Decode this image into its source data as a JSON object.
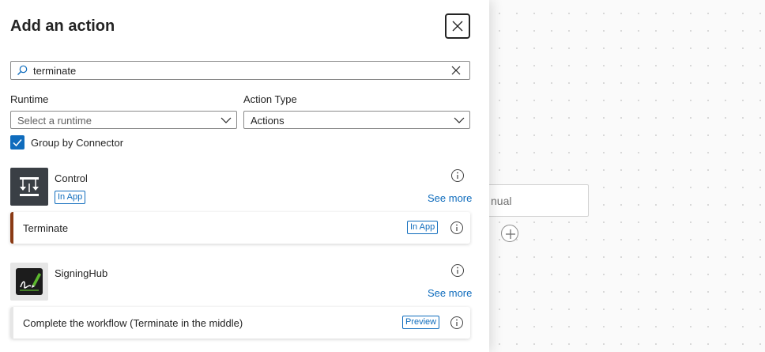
{
  "canvas": {
    "trigger_label": "nual"
  },
  "panel": {
    "title": "Add an action",
    "search": {
      "value": "terminate"
    },
    "runtime": {
      "label": "Runtime",
      "placeholder": "Select a runtime"
    },
    "action_type": {
      "label": "Action Type",
      "value": "Actions"
    },
    "group_by_connector": {
      "label": "Group by Connector",
      "checked": true
    },
    "connectors": [
      {
        "name": "Control",
        "badge": "In App",
        "see_more": "See more",
        "icon": "control-icon",
        "icon_bg": "#3a3f45",
        "actions": [
          {
            "label": "Terminate",
            "badge": "In App",
            "accent": "#8a3a14"
          }
        ]
      },
      {
        "name": "SigningHub",
        "see_more": "See more",
        "icon": "signinghub-icon",
        "icon_bg": "#e6e6e6",
        "actions": [
          {
            "label": "Complete the workflow (Terminate in the middle)",
            "badge": "Preview",
            "accent": "#e6e6e6"
          }
        ]
      }
    ]
  },
  "colors": {
    "accent_blue": "#0f6cbd"
  }
}
